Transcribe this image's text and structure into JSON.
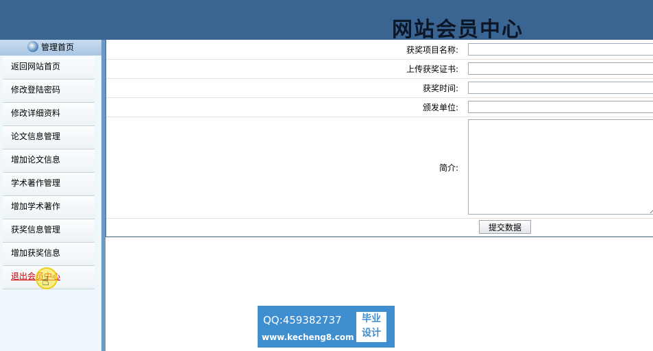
{
  "header": {
    "title": "网站会员中心"
  },
  "sidebar": {
    "head_label": "管理首页",
    "items": [
      {
        "label": "返回网站首页"
      },
      {
        "label": "修改登陆密码"
      },
      {
        "label": "修改详细资料"
      },
      {
        "label": "论文信息管理"
      },
      {
        "label": "增加论文信息"
      },
      {
        "label": "学术著作管理"
      },
      {
        "label": "增加学术著作"
      },
      {
        "label": "获奖信息管理"
      },
      {
        "label": "增加获奖信息"
      },
      {
        "label": "退出会员中心"
      }
    ]
  },
  "form": {
    "fields": [
      {
        "label": "获奖项目名称:",
        "value": ""
      },
      {
        "label": "上传获奖证书:",
        "value": ""
      },
      {
        "label": "获奖时间:",
        "value": ""
      },
      {
        "label": "颁发单位:",
        "value": ""
      }
    ],
    "intro_label": "简介:",
    "submit_label": "提交数据"
  },
  "watermark": {
    "qq": "QQ:459382737",
    "url": "www.kecheng8.com",
    "box_line1": "毕业",
    "box_line2": "设计"
  }
}
